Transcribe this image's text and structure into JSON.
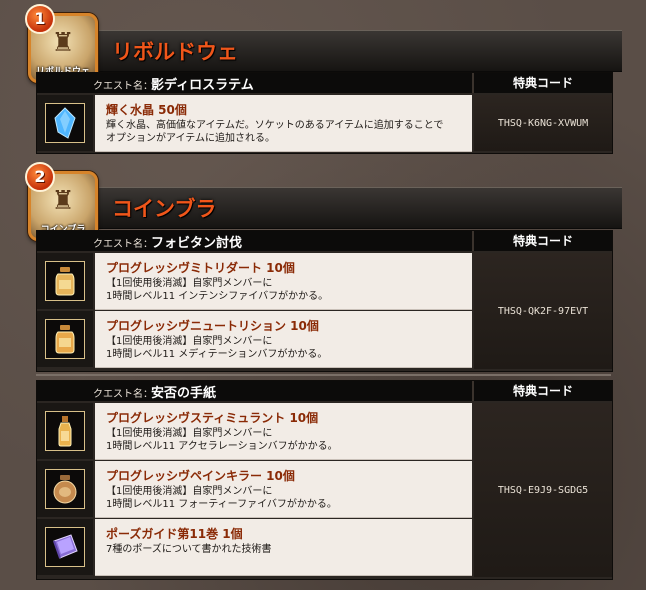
{
  "sections": [
    {
      "badge_number": "1",
      "emblem_caption": "リボルドウェ",
      "title": "リボルドウェ",
      "quests": [
        {
          "quest_label": "クエスト名：",
          "quest_name": "影ディロスラテム",
          "code_header": "特典コード",
          "code": "THSQ-K6NG-XVWUM",
          "items": [
            {
              "name": "輝く水晶 50個",
              "desc": "輝く水晶、高価値なアイテムだ。ソケットのあるアイテムに追加することで\nオプションがアイテムに追加される。",
              "icon": "crystal-icon"
            }
          ]
        }
      ]
    },
    {
      "badge_number": "2",
      "emblem_caption": "コインブラ",
      "title": "コインブラ",
      "quests": [
        {
          "quest_label": "クエスト名：",
          "quest_name": "フォビタン討伐",
          "code_header": "特典コード",
          "code": "THSQ-QK2F-97EVT",
          "items": [
            {
              "name": "プログレッシヴミトリダート 10個",
              "desc": "【1回使用後消滅】自家門メンバーに\n1時間レベル11 インテンシファイバフがかかる。",
              "icon": "potion-jar-icon"
            },
            {
              "name": "プログレッシヴニュートリション 10個",
              "desc": "【1回使用後消滅】自家門メンバーに\n1時間レベル11 メディテーションバフがかかる。",
              "icon": "potion-jar-icon"
            }
          ]
        },
        {
          "quest_label": "クエスト名：",
          "quest_name": "安否の手紙",
          "code_header": "特典コード",
          "code": "THSQ-E9J9-SGDG5",
          "items": [
            {
              "name": "プログレッシヴスティミュラント 10個",
              "desc": "【1回使用後消滅】自家門メンバーに\n1時間レベル11 アクセラレーションバフがかかる。",
              "icon": "potion-bottle-icon"
            },
            {
              "name": "プログレッシヴペインキラー 10個",
              "desc": "【1回使用後消滅】自家門メンバーに\n1時間レベル11 フォーティーファイバフがかかる。",
              "icon": "potion-jar-icon"
            },
            {
              "name": "ポーズガイド第11巻 1個",
              "desc": "7種のポーズについて書かれた技術書",
              "icon": "book-icon"
            }
          ]
        }
      ]
    }
  ]
}
